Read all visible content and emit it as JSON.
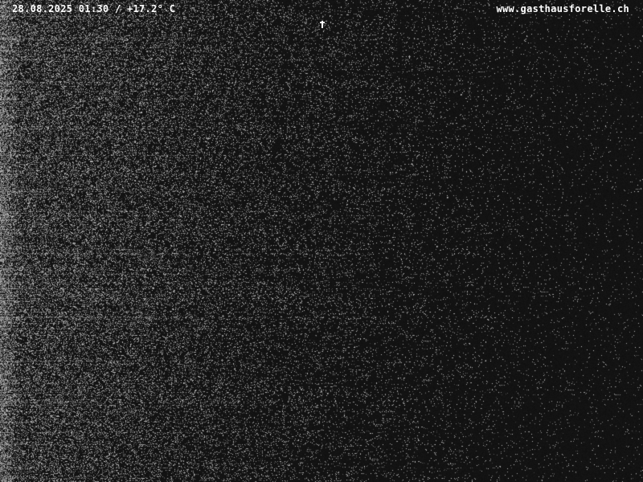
{
  "overlay": {
    "timestamp": "28.08.2025 01:30 / +17.2° C",
    "url": "www.gasthausforelle.ch"
  },
  "colors": {
    "background": "#131313",
    "text": "#ffffff"
  }
}
